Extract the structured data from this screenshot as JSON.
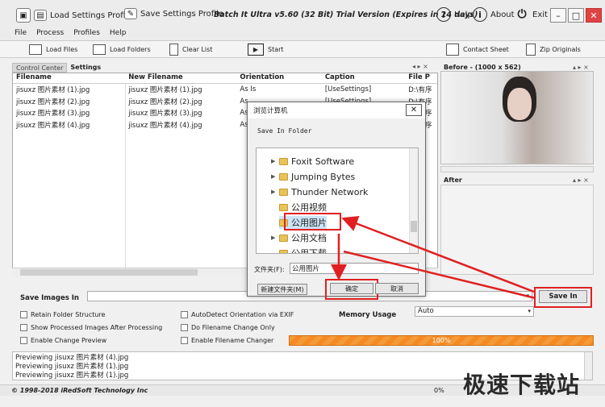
{
  "window": {
    "load_settings": "Load Settings Profile",
    "save_settings": "Save Settings Profile",
    "title": "Batch It Ultra v5.60 (32 Bit) Trial Version (Expires in 14 days)",
    "help": "Help",
    "about": "About",
    "exit": "Exit"
  },
  "menu": [
    "File",
    "Process",
    "Profiles",
    "Help"
  ],
  "toolbar": {
    "load_files": "Load Files",
    "load_folders": "Load Folders",
    "clear_list": "Clear List",
    "start": "Start",
    "contact_sheet": "Contact Sheet",
    "zip_originals": "Zip Originals"
  },
  "tabs": [
    "Control Center",
    "Settings"
  ],
  "table": {
    "headers": [
      "Filename",
      "New Filename",
      "Orientation",
      "Caption",
      "File P"
    ],
    "rows": [
      [
        "jisuxz 图片素材 (1).jpg",
        "jisuxz 图片素材 (1).jpg",
        "As Is",
        "[UseSettings]",
        "D:\\有序"
      ],
      [
        "jisuxz 图片素材 (2).jpg",
        "jisuxz 图片素材 (2).jpg",
        "As",
        "[UseSettings]",
        "D:\\有序"
      ],
      [
        "jisuxz 图片素材 (3).jpg",
        "jisuxz 图片素材 (3).jpg",
        "As",
        "",
        "D:\\有序"
      ],
      [
        "jisuxz 图片素材 (4).jpg",
        "jisuxz 图片素材 (4).jpg",
        "As",
        "",
        "D:\\有序"
      ]
    ]
  },
  "preview": {
    "before": "Before - (1000 x 562)",
    "after": "After"
  },
  "save": {
    "label": "Save Images In",
    "button": "Save In",
    "memory_label": "Memory Usage",
    "memory_value": "Auto"
  },
  "options": [
    "Retain Folder Structure",
    "Show Processed Images After Processing",
    "Enable Change Preview",
    "AutoDetect Orientation via EXIF",
    "Do Filename Change Only",
    "Enable Filename Changer"
  ],
  "progress": {
    "value": 1.0,
    "label": "100%"
  },
  "log": [
    "Previewing jisuxz 图片素材 (4).jpg",
    "Previewing jisuxz 图片素材 (1).jpg",
    "Previewing jisuxz 图片素材 (1).jpg"
  ],
  "status": {
    "copyright": "© 1998-2018 iRedSoft Technology Inc",
    "percent": "0%"
  },
  "dialog": {
    "title": "浏览计算机",
    "subtitle": "Save In Folder",
    "folders": [
      "Foxit Software",
      "Jumping Bytes",
      "Thunder Network",
      "公用视频",
      "公用图片",
      "公用文档",
      "公用下载"
    ],
    "folder_label": "文件夹(F):",
    "folder_value": "公用图片",
    "new_folder": "新建文件夹(M)",
    "ok": "确定",
    "cancel": "取消"
  },
  "watermark": "极速下载站",
  "colors": {
    "progress": "#f48a22",
    "highlight": "#e02020",
    "folder": "#e8c35b"
  }
}
